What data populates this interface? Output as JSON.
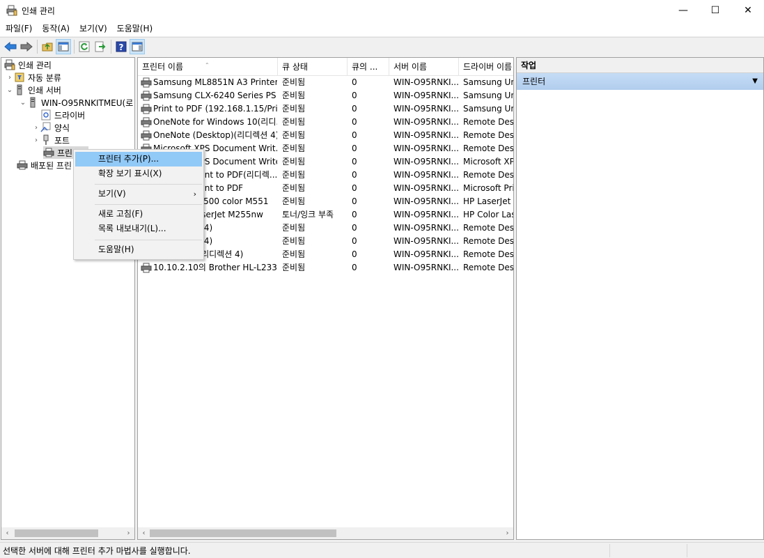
{
  "window": {
    "title": "인쇄 관리",
    "minimize": "—",
    "maximize": "☐",
    "close": "✕"
  },
  "menu": [
    "파일(F)",
    "동작(A)",
    "보기(V)",
    "도움말(H)"
  ],
  "tree": {
    "root": "인쇄 관리",
    "items": [
      {
        "label": "자동 분류"
      },
      {
        "label": "인쇄 서버"
      },
      {
        "label": "WIN-O95RNKITMEU(로"
      },
      {
        "label": "드라이버"
      },
      {
        "label": "양식"
      },
      {
        "label": "포트"
      },
      {
        "label": "프린터"
      },
      {
        "label": "배포된 프린"
      }
    ]
  },
  "columns": [
    "프린터 이름",
    "큐 상태",
    "큐의 ...",
    "서버 이름",
    "드라이버 이름"
  ],
  "rows": [
    {
      "name": "Samsung ML8851N A3 Printer",
      "status": "준비됨",
      "jobs": "0",
      "server": "WIN-O95RNKI...",
      "driver": "Samsung Uni"
    },
    {
      "name": "Samsung CLX-6240 Series PS",
      "status": "준비됨",
      "jobs": "0",
      "server": "WIN-O95RNKI...",
      "driver": "Samsung Uni"
    },
    {
      "name": "Print to PDF (192.168.1.15/Pri...",
      "status": "준비됨",
      "jobs": "0",
      "server": "WIN-O95RNKI...",
      "driver": "Samsung Uni"
    },
    {
      "name": "OneNote for Windows 10(리디...",
      "status": "준비됨",
      "jobs": "0",
      "server": "WIN-O95RNKI...",
      "driver": "Remote Desk"
    },
    {
      "name": "OneNote (Desktop)(리디렉션 4)",
      "status": "준비됨",
      "jobs": "0",
      "server": "WIN-O95RNKI...",
      "driver": "Remote Desk"
    },
    {
      "name": "Microsoft XPS Document Writ...",
      "status": "준비됨",
      "jobs": "0",
      "server": "WIN-O95RNKI...",
      "driver": "Remote Desk"
    },
    {
      "name": "Microsoft XPS Document Writer",
      "status": "준비됨",
      "jobs": "0",
      "server": "WIN-O95RNKI...",
      "driver": "Microsoft XPS"
    },
    {
      "name": "Microsoft Print to PDF(리디렉...",
      "status": "준비됨",
      "jobs": "0",
      "server": "WIN-O95RNKI...",
      "driver": "Remote Desk"
    },
    {
      "name": "Microsoft Print to PDF",
      "status": "준비됨",
      "jobs": "0",
      "server": "WIN-O95RNKI...",
      "driver": "Microsoft Prin"
    },
    {
      "name": "HP LaserJet 500 color M551",
      "status": "준비됨",
      "jobs": "0",
      "server": "WIN-O95RNKI...",
      "driver": "HP LaserJet 5"
    },
    {
      "name": "HP Color LaserJet M255nw",
      "status": "토너/잉크 부족",
      "jobs": "0",
      "server": "WIN-O95RNKI...",
      "driver": "HP Color Las"
    },
    {
      "name": "Fax(리디렉션 4)",
      "status": "준비됨",
      "jobs": "0",
      "server": "WIN-O95RNKI...",
      "driver": "Remote Desk"
    },
    {
      "name": "Fax(리디렉션 4)",
      "status": "준비됨",
      "jobs": "0",
      "server": "WIN-O95RNKI...",
      "driver": "Remote Desk"
    },
    {
      "name": "Brother HL(리디렉션 4)",
      "status": "준비됨",
      "jobs": "0",
      "server": "WIN-O95RNKI...",
      "driver": "Remote Desk"
    },
    {
      "name": "10.10.2.10의 Brother HL-L233...",
      "status": "준비됨",
      "jobs": "0",
      "server": "WIN-O95RNKI...",
      "driver": "Remote Desk"
    }
  ],
  "actions": {
    "header": "작업",
    "group": "프린터"
  },
  "context_menu": {
    "add_printer": "프린터 추가(P)...",
    "extended_view": "확장 보기 표시(X)",
    "view": "보기(V)",
    "refresh": "새로 고침(F)",
    "export": "목록 내보내기(L)...",
    "help": "도움말(H)"
  },
  "status": "선택한 서버에 대해 프린터 추가 마법사를 실행합니다.",
  "colors": {
    "accent": "#91c9f7",
    "actions_group": "#b8d3f2"
  }
}
